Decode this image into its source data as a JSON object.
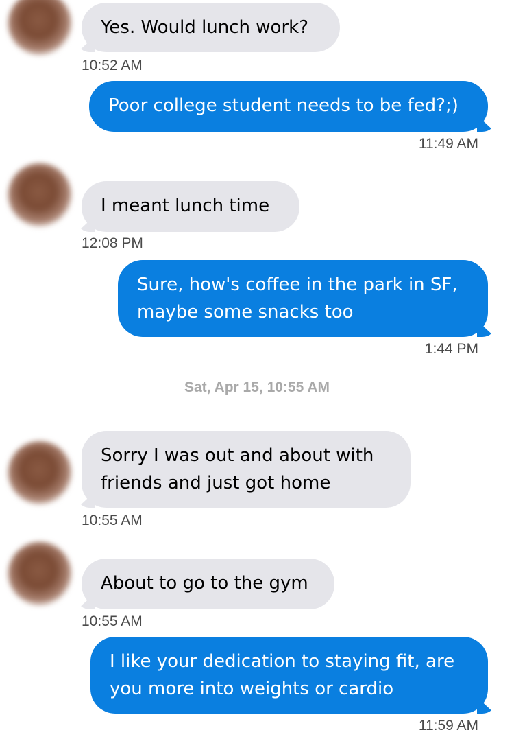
{
  "messages": [
    {
      "direction": "incoming",
      "text": "Yes. Would lunch work?",
      "time": "10:52 AM"
    },
    {
      "direction": "outgoing",
      "text": "Poor college student needs to be fed?;)",
      "time": "11:49 AM"
    },
    {
      "direction": "incoming",
      "text": "I meant lunch time",
      "time": "12:08 PM"
    },
    {
      "direction": "outgoing",
      "text": "Sure, how's coffee in the park in SF, maybe some snacks too",
      "time": "1:44 PM"
    },
    {
      "date_separator": "Sat, Apr 15, 10:55 AM"
    },
    {
      "direction": "incoming",
      "text": "Sorry I was out and about with friends and just got home",
      "time": "10:55 AM"
    },
    {
      "direction": "incoming",
      "text": "About to go to the gym",
      "time": "10:55 AM"
    },
    {
      "direction": "outgoing",
      "text": "I like your dedication to staying fit, are you more into weights or cardio",
      "time": "11:59 AM"
    }
  ],
  "colors": {
    "incoming_bubble": "#e5e5ea",
    "outgoing_bubble": "#0a7fe0",
    "outgoing_text": "#ffffff",
    "timestamp": "#4a4a4a",
    "date_separator": "#a9a9a9"
  },
  "icons": {
    "avatar": "blurred-profile-photo"
  }
}
